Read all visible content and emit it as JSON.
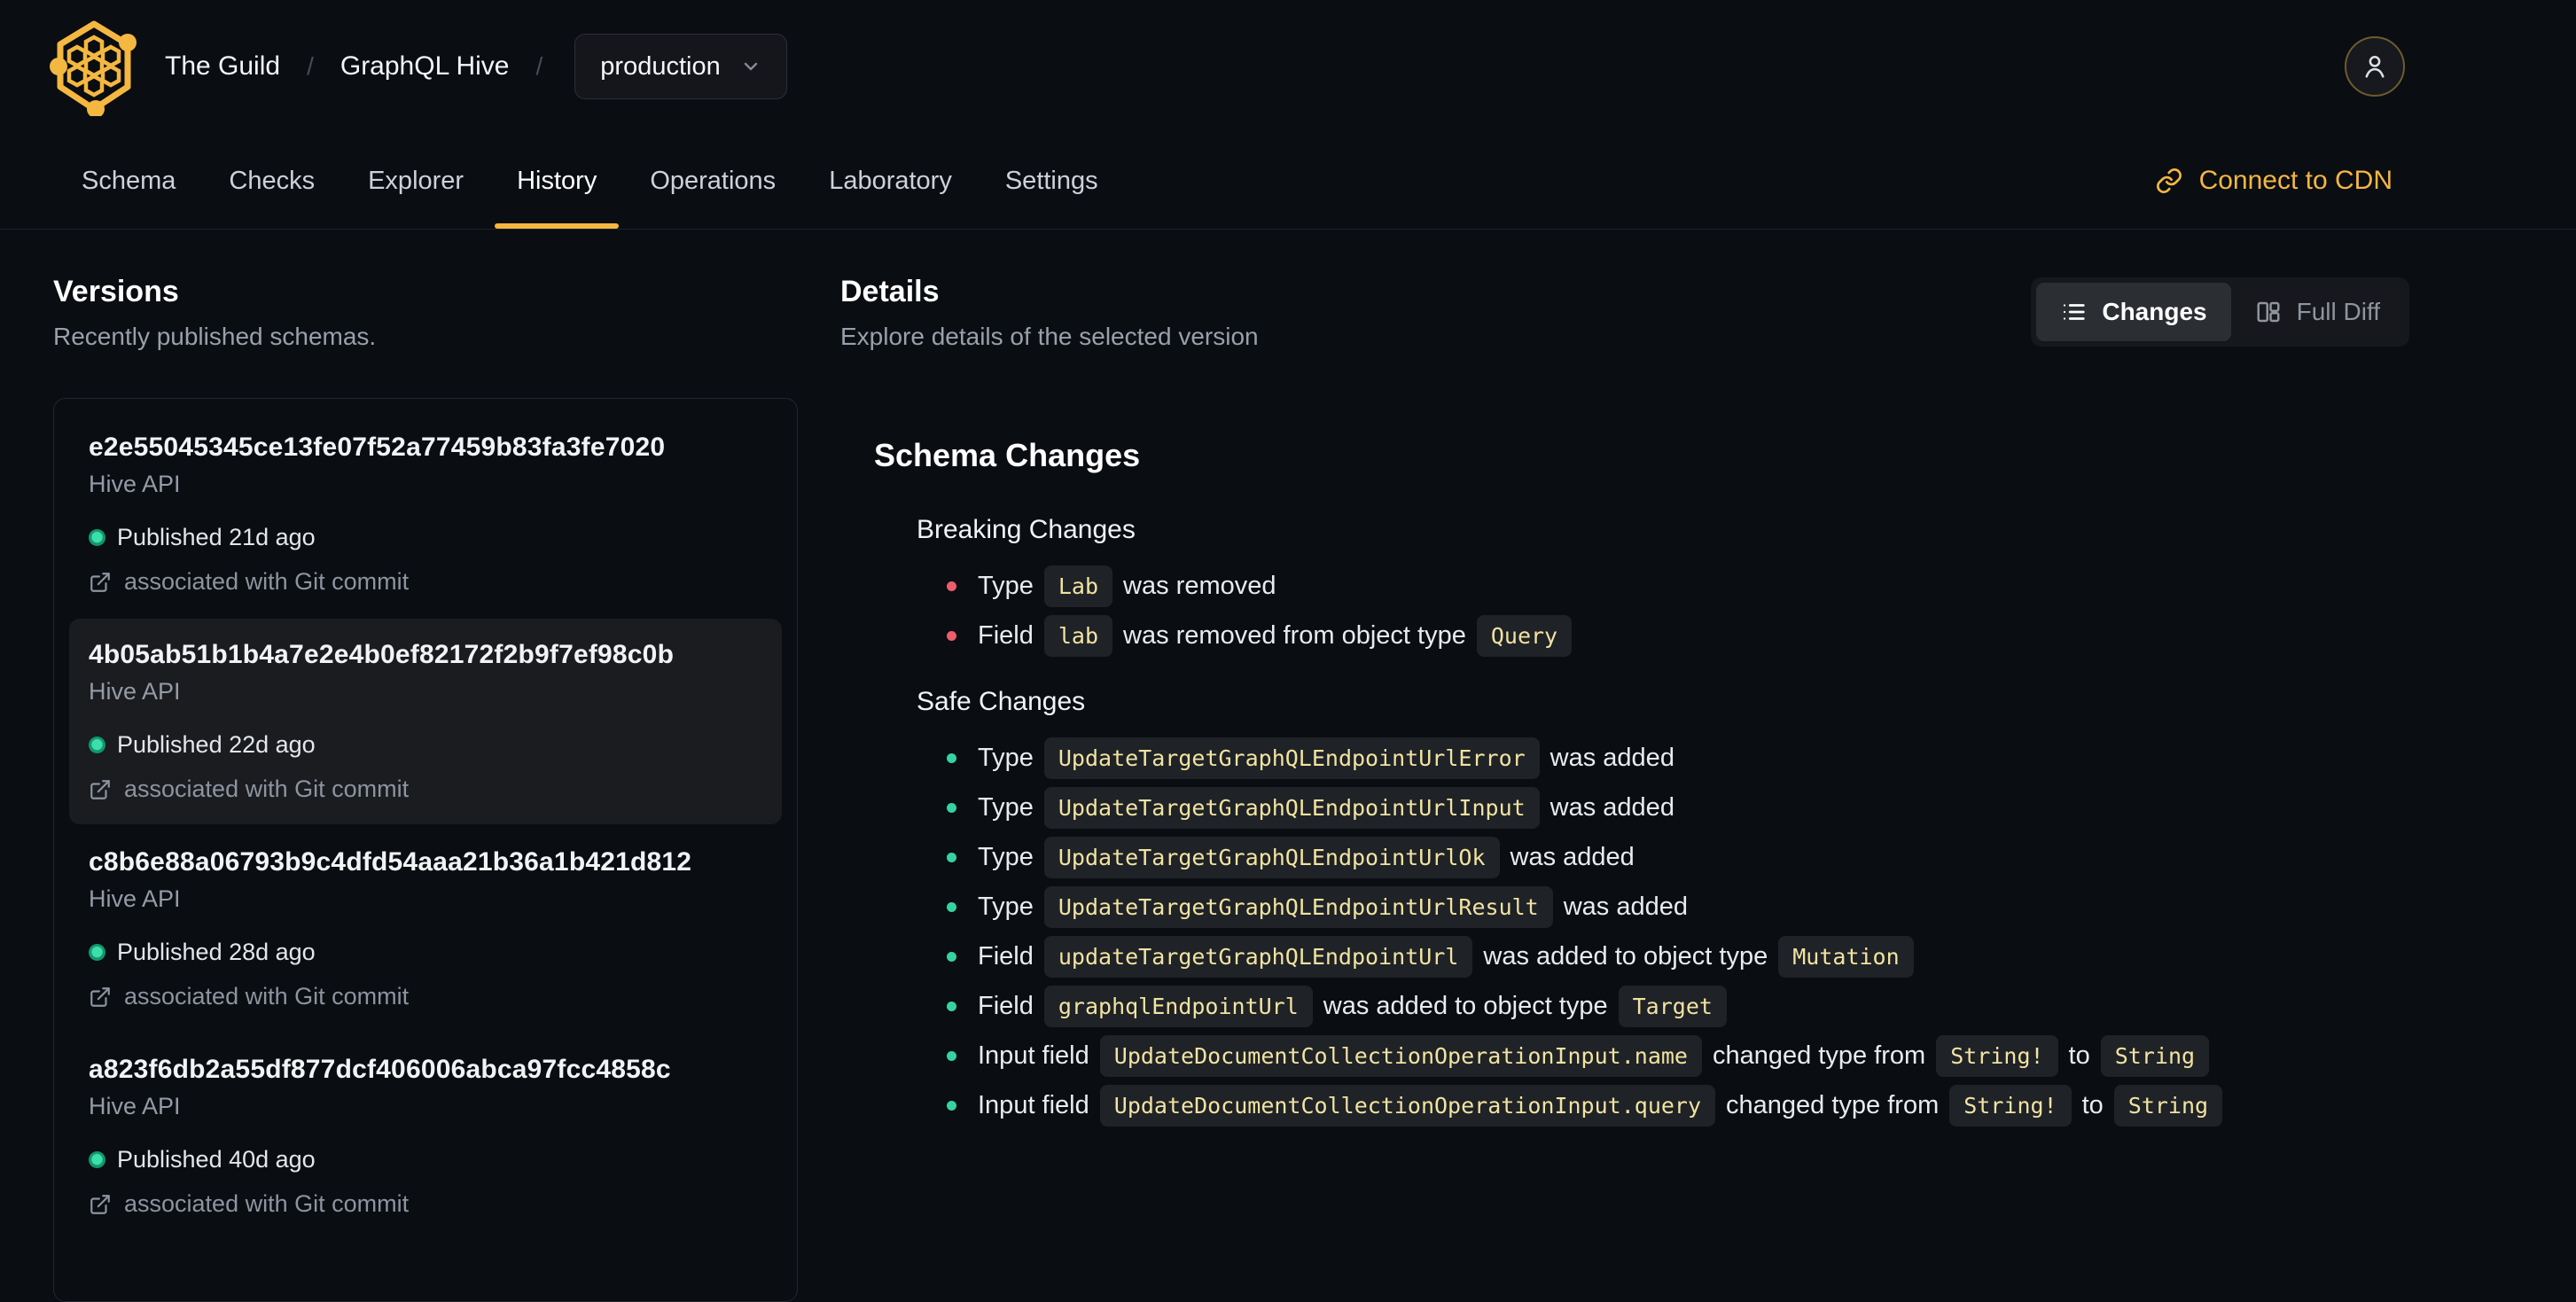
{
  "header": {
    "breadcrumb": {
      "org": "The Guild",
      "separator": "/",
      "project": "GraphQL Hive",
      "target": "production"
    },
    "tabs": [
      {
        "label": "Schema"
      },
      {
        "label": "Checks"
      },
      {
        "label": "Explorer"
      },
      {
        "label": "History"
      },
      {
        "label": "Operations"
      },
      {
        "label": "Laboratory"
      },
      {
        "label": "Settings"
      }
    ],
    "active_tab": "History",
    "cdn_link": "Connect to CDN"
  },
  "versions": {
    "title": "Versions",
    "subtitle": "Recently published schemas.",
    "items": [
      {
        "hash": "e2e55045345ce13fe07f52a77459b83fa3fe7020",
        "service": "Hive API",
        "status": "Published 21d ago",
        "git": "associated with Git commit",
        "selected": false
      },
      {
        "hash": "4b05ab51b1b4a7e2e4b0ef82172f2b9f7ef98c0b",
        "service": "Hive API",
        "status": "Published 22d ago",
        "git": "associated with Git commit",
        "selected": true
      },
      {
        "hash": "c8b6e88a06793b9c4dfd54aaa21b36a1b421d812",
        "service": "Hive API",
        "status": "Published 28d ago",
        "git": "associated with Git commit",
        "selected": false
      },
      {
        "hash": "a823f6db2a55df877dcf406006abca97fcc4858c",
        "service": "Hive API",
        "status": "Published 40d ago",
        "git": "associated with Git commit",
        "selected": false
      }
    ]
  },
  "details": {
    "title": "Details",
    "subtitle": "Explore details of the selected version",
    "view_toggle": {
      "changes": "Changes",
      "full_diff": "Full Diff",
      "active": "Changes"
    },
    "schema_changes": {
      "title": "Schema Changes",
      "breaking": {
        "title": "Breaking Changes",
        "items": [
          {
            "parts": [
              {
                "t": "text",
                "v": "Type"
              },
              {
                "t": "code",
                "v": "Lab"
              },
              {
                "t": "text",
                "v": "was removed"
              }
            ]
          },
          {
            "parts": [
              {
                "t": "text",
                "v": "Field"
              },
              {
                "t": "code",
                "v": "lab"
              },
              {
                "t": "text",
                "v": "was removed from object type"
              },
              {
                "t": "code",
                "v": "Query"
              }
            ]
          }
        ]
      },
      "safe": {
        "title": "Safe Changes",
        "items": [
          {
            "parts": [
              {
                "t": "text",
                "v": "Type"
              },
              {
                "t": "code",
                "v": "UpdateTargetGraphQLEndpointUrlError"
              },
              {
                "t": "text",
                "v": "was added"
              }
            ]
          },
          {
            "parts": [
              {
                "t": "text",
                "v": "Type"
              },
              {
                "t": "code",
                "v": "UpdateTargetGraphQLEndpointUrlInput"
              },
              {
                "t": "text",
                "v": "was added"
              }
            ]
          },
          {
            "parts": [
              {
                "t": "text",
                "v": "Type"
              },
              {
                "t": "code",
                "v": "UpdateTargetGraphQLEndpointUrlOk"
              },
              {
                "t": "text",
                "v": "was added"
              }
            ]
          },
          {
            "parts": [
              {
                "t": "text",
                "v": "Type"
              },
              {
                "t": "code",
                "v": "UpdateTargetGraphQLEndpointUrlResult"
              },
              {
                "t": "text",
                "v": "was added"
              }
            ]
          },
          {
            "parts": [
              {
                "t": "text",
                "v": "Field"
              },
              {
                "t": "code",
                "v": "updateTargetGraphQLEndpointUrl"
              },
              {
                "t": "text",
                "v": "was added to object type"
              },
              {
                "t": "code",
                "v": "Mutation"
              }
            ]
          },
          {
            "parts": [
              {
                "t": "text",
                "v": "Field"
              },
              {
                "t": "code",
                "v": "graphqlEndpointUrl"
              },
              {
                "t": "text",
                "v": "was added to object type"
              },
              {
                "t": "code",
                "v": "Target"
              }
            ]
          },
          {
            "parts": [
              {
                "t": "text",
                "v": "Input field"
              },
              {
                "t": "code",
                "v": "UpdateDocumentCollectionOperationInput.name"
              },
              {
                "t": "text",
                "v": "changed type from"
              },
              {
                "t": "code",
                "v": "String!"
              },
              {
                "t": "text",
                "v": "to"
              },
              {
                "t": "code",
                "v": "String"
              }
            ]
          },
          {
            "parts": [
              {
                "t": "text",
                "v": "Input field"
              },
              {
                "t": "code",
                "v": "UpdateDocumentCollectionOperationInput.query"
              },
              {
                "t": "text",
                "v": "changed type from"
              },
              {
                "t": "code",
                "v": "String!"
              },
              {
                "t": "text",
                "v": "to"
              },
              {
                "t": "code",
                "v": "String"
              }
            ]
          }
        ]
      }
    }
  },
  "colors": {
    "background": "#0a0d12",
    "accent": "#f4b740",
    "published_dot": "#2fd49c",
    "breaking_bullet": "#ee5d6c",
    "safe_bullet": "#35d39f",
    "code_text": "#f1e3a1",
    "code_bg": "#1f2227",
    "selected_card_bg": "#1a1c20"
  },
  "icons": {
    "hive-logo-icon": "honeycomb-hexagon",
    "chevron-down-icon": "chevron-down",
    "user-icon": "person-outline",
    "link-icon": "chain-link",
    "list-icon": "bulleted-list",
    "columns-icon": "split-panes",
    "external-link-icon": "box-arrow-out"
  }
}
